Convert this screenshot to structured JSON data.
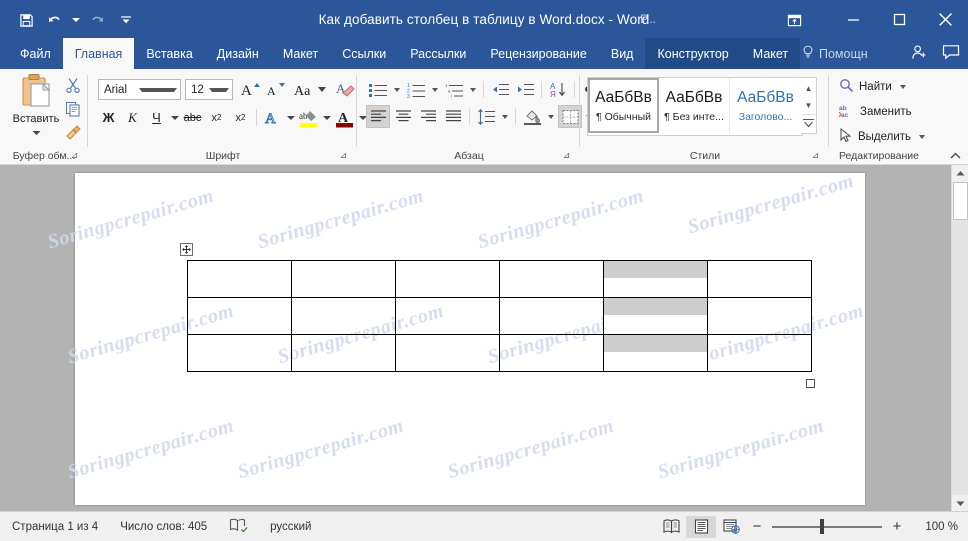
{
  "window": {
    "title": "Как добавить столбец в таблицу в Word.docx  -  Word",
    "account_label": "Р...",
    "account_name_redacted": true,
    "theme_color": "#2b579a"
  },
  "quick_access": [
    {
      "name": "save-icon",
      "label": "Сохранить"
    },
    {
      "name": "undo-icon",
      "label": "Отменить"
    },
    {
      "name": "redo-icon",
      "label": "Вернуть"
    },
    {
      "name": "customize-qat-icon",
      "label": "Настройка панели быстрого доступа"
    }
  ],
  "window_controls": [
    {
      "name": "ribbon-display-options-icon",
      "label": "Параметры отображения ленты"
    },
    {
      "name": "minimize-icon",
      "label": "Свернуть"
    },
    {
      "name": "maximize-icon",
      "label": "Развернуть"
    },
    {
      "name": "close-icon",
      "label": "Закрыть"
    }
  ],
  "tabs": [
    {
      "label": "Файл",
      "active": false,
      "contextual": false
    },
    {
      "label": "Главная",
      "active": true,
      "contextual": false
    },
    {
      "label": "Вставка",
      "active": false,
      "contextual": false
    },
    {
      "label": "Дизайн",
      "active": false,
      "contextual": false
    },
    {
      "label": "Макет",
      "active": false,
      "contextual": false
    },
    {
      "label": "Ссылки",
      "active": false,
      "contextual": false
    },
    {
      "label": "Рассылки",
      "active": false,
      "contextual": false
    },
    {
      "label": "Рецензирование",
      "active": false,
      "contextual": false
    },
    {
      "label": "Вид",
      "active": false,
      "contextual": false
    },
    {
      "label": "Конструктор",
      "active": false,
      "contextual": true
    },
    {
      "label": "Макет",
      "active": false,
      "contextual": true
    }
  ],
  "tell_me": {
    "label": "Помощн",
    "icon": "lightbulb-icon"
  },
  "titlebar_right_icons": [
    {
      "name": "share-person-icon",
      "label": "Общий доступ"
    },
    {
      "name": "comments-icon",
      "label": "Примечания"
    }
  ],
  "ribbon": {
    "clipboard": {
      "group_label": "Буфер обм...",
      "paste_label": "Вставить",
      "buttons": [
        {
          "name": "cut-icon",
          "label": "Вырезать"
        },
        {
          "name": "copy-icon",
          "label": "Копировать"
        },
        {
          "name": "format-painter-icon",
          "label": "Формат по образцу"
        }
      ]
    },
    "font": {
      "group_label": "Шрифт",
      "font_family": "Arial",
      "font_size": "12",
      "buttons": [
        {
          "name": "grow-font-icon",
          "label": "Увеличить размер"
        },
        {
          "name": "shrink-font-icon",
          "label": "Уменьшить размер"
        },
        {
          "name": "change-case-icon",
          "label": "Регистр"
        },
        {
          "name": "clear-formatting-icon",
          "label": "Очистить формат"
        },
        {
          "name": "bold-icon",
          "label": "Ж"
        },
        {
          "name": "italic-icon",
          "label": "К"
        },
        {
          "name": "underline-icon",
          "label": "Ч"
        },
        {
          "name": "strikethrough-icon",
          "label": "abc"
        },
        {
          "name": "subscript-icon",
          "label": "x₂"
        },
        {
          "name": "superscript-icon",
          "label": "x²"
        },
        {
          "name": "text-effects-icon",
          "label": "A"
        },
        {
          "name": "highlight-color-icon",
          "label": "ab"
        },
        {
          "name": "font-color-icon",
          "label": "A"
        }
      ]
    },
    "paragraph": {
      "group_label": "Абзац",
      "buttons": [
        {
          "name": "bullets-icon",
          "label": "Маркеры"
        },
        {
          "name": "numbering-icon",
          "label": "Нумерация"
        },
        {
          "name": "multilevel-list-icon",
          "label": "Многоуровневый список"
        },
        {
          "name": "decrease-indent-icon",
          "label": "Уменьшить отступ"
        },
        {
          "name": "increase-indent-icon",
          "label": "Увеличить отступ"
        },
        {
          "name": "sort-icon",
          "label": "Сортировка"
        },
        {
          "name": "show-marks-icon",
          "label": "Отобразить все знаки"
        },
        {
          "name": "align-left-icon",
          "label": "По левому краю"
        },
        {
          "name": "align-center-icon",
          "label": "По центру"
        },
        {
          "name": "align-right-icon",
          "label": "По правому краю"
        },
        {
          "name": "justify-icon",
          "label": "По ширине"
        },
        {
          "name": "line-spacing-icon",
          "label": "Интервал"
        },
        {
          "name": "shading-icon",
          "label": "Заливка"
        },
        {
          "name": "borders-icon",
          "label": "Границы"
        }
      ]
    },
    "styles": {
      "group_label": "Стили",
      "items": [
        {
          "preview": "АаБбВв",
          "name": "¶ Обычный",
          "selected": true,
          "blue": false
        },
        {
          "preview": "АаБбВв",
          "name": "¶ Без инте...",
          "selected": false,
          "blue": false
        },
        {
          "preview": "АаБбВв",
          "name": "Заголово...",
          "selected": false,
          "blue": true
        }
      ],
      "scroll": [
        {
          "name": "styles-scroll-up-icon",
          "glyph": "▲"
        },
        {
          "name": "styles-scroll-down-icon",
          "glyph": "▼"
        },
        {
          "name": "styles-more-icon",
          "glyph": "▼"
        }
      ]
    },
    "editing": {
      "group_label": "Редактирование",
      "items": [
        {
          "label": "Найти",
          "icon": "search-icon",
          "has_dropdown": true
        },
        {
          "label": "Заменить",
          "icon": "replace-icon",
          "has_dropdown": false
        },
        {
          "label": "Выделить",
          "icon": "select-pointer-icon",
          "has_dropdown": true
        }
      ],
      "collapse_icon": "collapse-ribbon-icon"
    }
  },
  "document": {
    "watermark_text": "Soringpcrepair.com",
    "table": {
      "columns": 6,
      "rows": 3,
      "selected_column_index": 5,
      "move_handle_icon": "table-move-handle-icon",
      "resize_handle_icon": "table-resize-handle-icon"
    }
  },
  "status_bar": {
    "page_info": "Страница 1 из 4",
    "word_count": "Число слов: 405",
    "proofing_icon": "proofing-errors-icon",
    "language": "русский",
    "views": [
      {
        "name": "read-mode-icon",
        "label": "Режим чтения",
        "selected": false
      },
      {
        "name": "print-layout-icon",
        "label": "Разметка страницы",
        "selected": true
      },
      {
        "name": "web-layout-icon",
        "label": "Веб-документ",
        "selected": false
      }
    ],
    "zoom_out_label": "−",
    "zoom_in_label": "+",
    "zoom_percent": "100 %"
  }
}
